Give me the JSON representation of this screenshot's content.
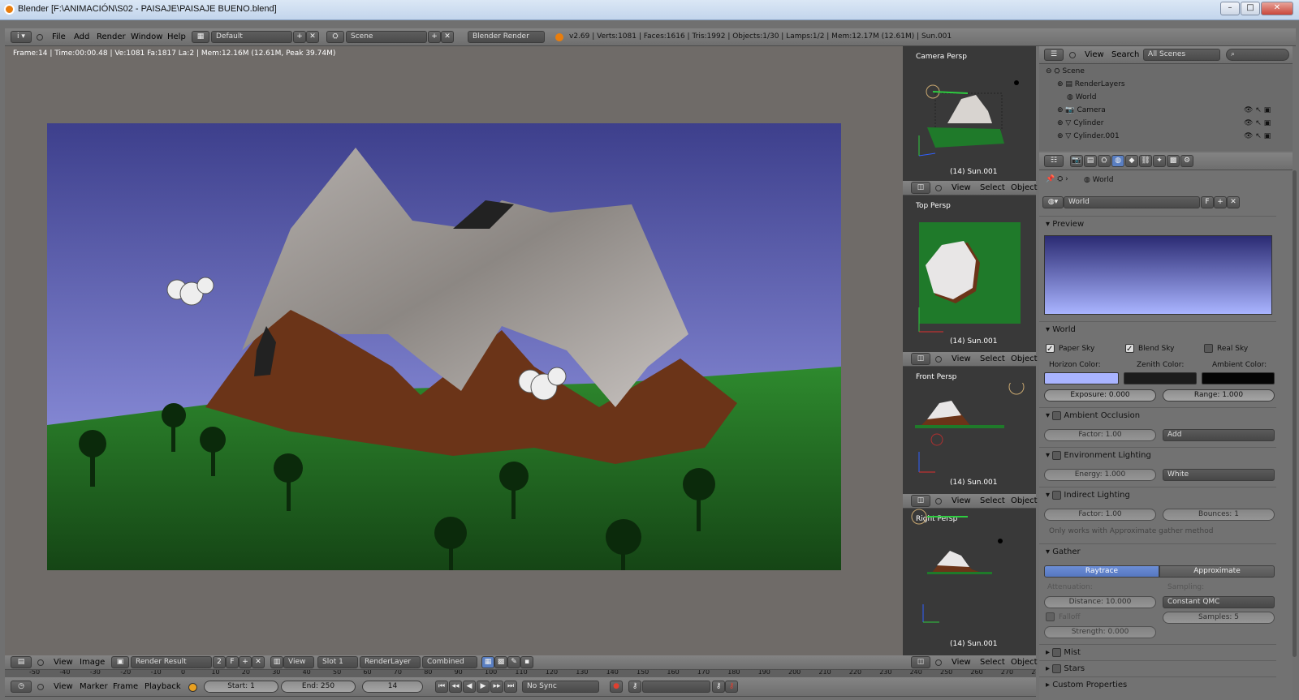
{
  "window": {
    "title": "Blender [F:\\ANIMACIÓN\\S02 - PAISAJE\\PAISAJE BUENO.blend]",
    "min": "–",
    "max": "□",
    "close": "✕"
  },
  "topbar": {
    "menus": [
      "File",
      "Add",
      "Render",
      "Window",
      "Help"
    ],
    "layout": "Default",
    "scene": "Scene",
    "engine": "Blender Render",
    "stats": "v2.69 | Verts:1081 | Faces:1616 | Tris:1992 | Objects:1/30 | Lamps:1/2 | Mem:12.17M (12.61M) | Sun.001"
  },
  "image_editor": {
    "info": "Frame:14 | Time:00:00.48 | Ve:1081 Fa:1817 La:2 | Mem:12.16M (12.61M, Peak 39.74M)",
    "header": {
      "view": "View",
      "image": "Image",
      "image_name": "Render Result",
      "users": "2",
      "fake": "F",
      "view2": "View",
      "slot": "Slot 1",
      "layer": "RenderLayer",
      "pass": "Combined"
    }
  },
  "viewports": [
    {
      "name": "Camera Persp",
      "obj": "(14) Sun.001"
    },
    {
      "name": "Top Persp",
      "obj": "(14) Sun.001"
    },
    {
      "name": "Front Persp",
      "obj": "(14) Sun.001"
    },
    {
      "name": "Right Persp",
      "obj": "(14) Sun.001"
    }
  ],
  "vp_header": {
    "view": "View",
    "select": "Select",
    "object": "Object"
  },
  "outliner": {
    "view": "View",
    "search": "Search",
    "scenes": "All Scenes",
    "items": [
      {
        "label": "Scene"
      },
      {
        "label": "RenderLayers"
      },
      {
        "label": "World"
      },
      {
        "label": "Camera"
      },
      {
        "label": "Cylinder"
      },
      {
        "label": "Cylinder.001"
      }
    ]
  },
  "properties": {
    "breadcrumb": "World",
    "world_field": "World",
    "world_f": "F",
    "preview": "Preview",
    "world_section": "World",
    "paper_sky": "Paper Sky",
    "blend_sky": "Blend Sky",
    "real_sky": "Real Sky",
    "horizon": "Horizon Color:",
    "zenith": "Zenith Color:",
    "ambient": "Ambient Color:",
    "exposure": "Exposure: 0.000",
    "range": "Range: 1.000",
    "ao": "Ambient Occlusion",
    "ao_factor": "Factor: 1.00",
    "ao_mode": "Add",
    "env": "Environment Lighting",
    "env_energy": "Energy: 1.000",
    "env_color": "White",
    "indirect": "Indirect Lighting",
    "ind_factor": "Factor: 1.00",
    "ind_bounces": "Bounces: 1",
    "ind_note": "Only works with Approximate gather method",
    "gather": "Gather",
    "raytrace": "Raytrace",
    "approximate": "Approximate",
    "attenuation": "Attenuation:",
    "sampling": "Sampling:",
    "distance": "Distance: 10.000",
    "qmc": "Constant QMC",
    "falloff": "Falloff",
    "samples": "Samples: 5",
    "strength": "Strength: 0.000",
    "mist": "Mist",
    "stars": "Stars",
    "custom": "Custom Properties",
    "colors": {
      "horizon": "#a9b4ff",
      "zenith": "#1c1c1c",
      "ambient": "#050505"
    }
  },
  "timeline": {
    "ticks": [
      "-50",
      "-40",
      "-30",
      "-20",
      "-10",
      "0",
      "10",
      "20",
      "30",
      "40",
      "50",
      "60",
      "70",
      "80",
      "90",
      "100",
      "110",
      "120",
      "130",
      "140",
      "150",
      "160",
      "170",
      "180",
      "190",
      "200",
      "210",
      "220",
      "230",
      "240",
      "250",
      "260",
      "270",
      "280"
    ],
    "view": "View",
    "marker": "Marker",
    "frame": "Frame",
    "playback": "Playback",
    "start": "Start: 1",
    "end": "End: 250",
    "current": "14",
    "sync": "No Sync"
  }
}
